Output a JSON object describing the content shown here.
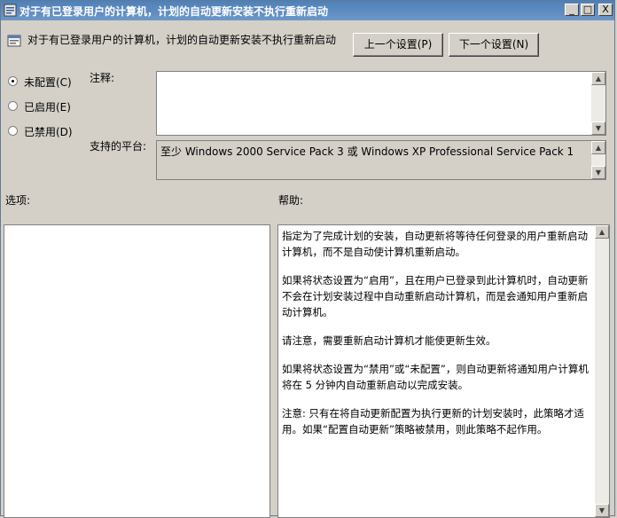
{
  "window": {
    "title": "对于有已登录用户的计算机，计划的自动更新安装不执行重新启动",
    "minimize_glyph": "_",
    "maximize_glyph": "□",
    "close_glyph": "X",
    "icon": "policy-window-icon"
  },
  "header": {
    "policy_name": "对于有已登录用户的计算机，计划的自动更新安装不执行重新启动",
    "prev_button": "上一个设置(P)",
    "next_button": "下一个设置(N)"
  },
  "state": {
    "not_configured": "未配置(C)",
    "enabled": "已启用(E)",
    "disabled": "已禁用(D)",
    "selected": "not_configured"
  },
  "notes": {
    "label": "注释:",
    "value": ""
  },
  "platform": {
    "label": "支持的平台:",
    "value": "至少 Windows 2000 Service Pack 3 或 Windows XP Professional Service Pack 1"
  },
  "options": {
    "label": "选项:"
  },
  "help": {
    "label": "帮助:",
    "paragraphs": [
      "指定为了完成计划的安装，自动更新将等待任何登录的用户重新启动计算机，而不是自动使计算机重新启动。",
      "如果将状态设置为“启用”，且在用户已登录到此计算机时，自动更新不会在计划安装过程中自动重新启动计算机，而是会通知用户重新启动计算机。",
      "请注意，需要重新启动计算机才能使更新生效。",
      "如果将状态设置为“禁用”或“未配置”，则自动更新将通知用户计算机将在 5 分钟内自动重新启动以完成安装。",
      "注意: 只有在将自动更新配置为执行更新的计划安装时，此策略才适用。如果“配置自动更新”策略被禁用，则此策略不起作用。"
    ]
  },
  "colors": {
    "titlebar": "#4e80b8",
    "face": "#d4d0c8"
  }
}
